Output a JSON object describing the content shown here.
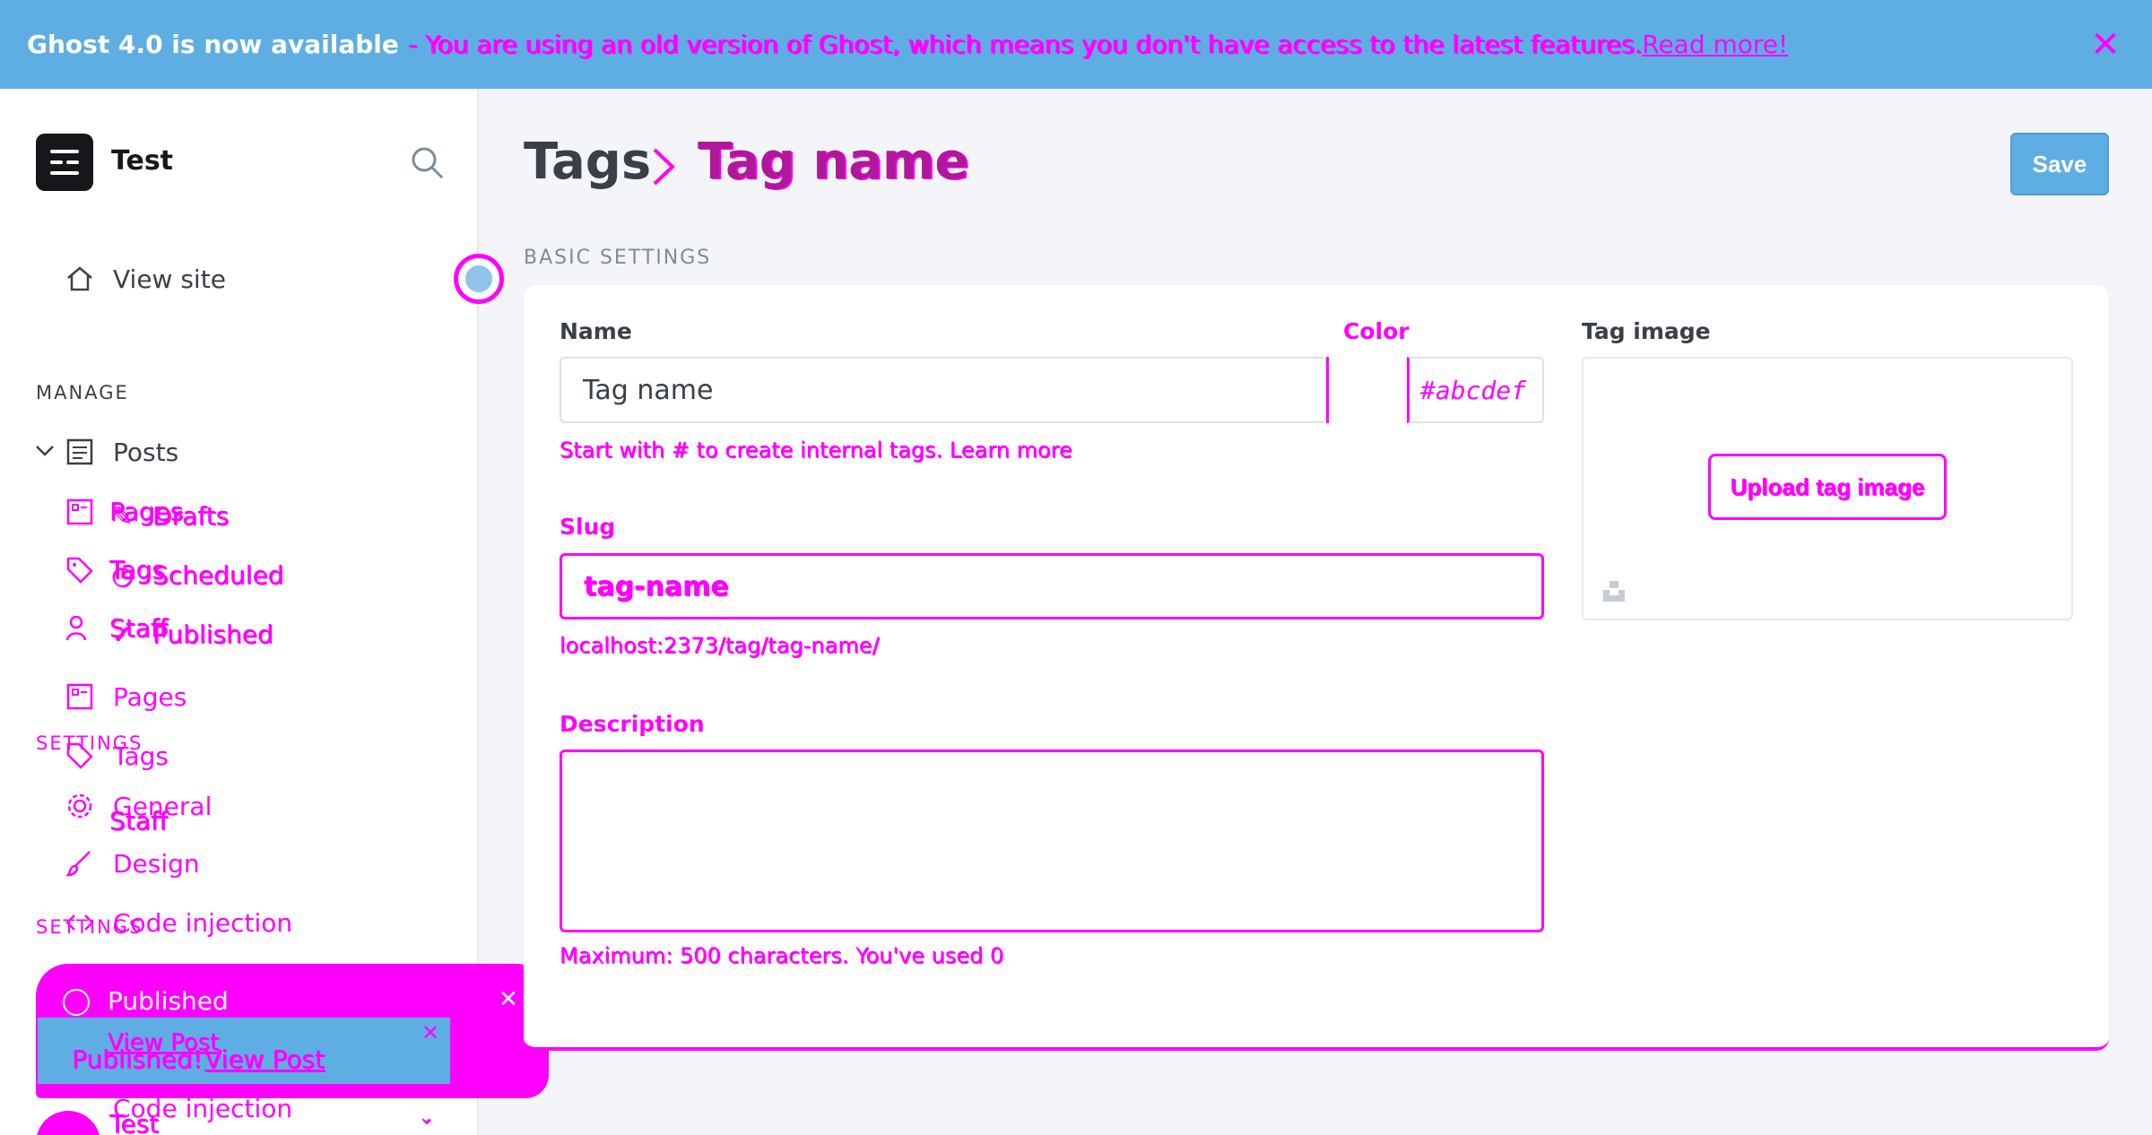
{
  "banner": {
    "title": "Ghost 4.0 is now available",
    "message": "- You are using an old version of Ghost, which means you don't have access to the latest features.",
    "link": "Read more!",
    "colors": {
      "background": "#5eaee3",
      "glitch": "#ff00ff"
    }
  },
  "sidebar": {
    "site_title": "Test",
    "view_site": "View site",
    "manage_label": "MANAGE",
    "settings_label": "SETTINGS",
    "settings_label_2": "SETTINGS",
    "items": [
      {
        "label": "Posts",
        "icon": "posts-icon"
      },
      {
        "label": "Pages",
        "icon": "pages-icon"
      },
      {
        "label": "Tags",
        "icon": "tag-icon"
      },
      {
        "label": "Staff",
        "icon": "staff-icon"
      },
      {
        "label": "Pages",
        "icon": "pages-icon"
      },
      {
        "label": "Tags",
        "icon": "tag-icon"
      },
      {
        "label": "Staff",
        "icon": "staff-icon"
      },
      {
        "label": "General",
        "icon": "gear-icon"
      },
      {
        "label": "Design",
        "icon": "brush-icon"
      },
      {
        "label": "Code injection",
        "icon": "code-icon"
      },
      {
        "label": "Code injection",
        "icon": "code-icon"
      },
      {
        "label": "Test",
        "icon": "avatar-icon"
      }
    ],
    "post_sub": [
      "Drafts",
      "Scheduled",
      "Published"
    ]
  },
  "toast": {
    "title": "Published",
    "inner_link": "View Post",
    "inner_text": "Published!",
    "inner_link_2": "View Post"
  },
  "header": {
    "breadcrumb_parent": "Tags",
    "breadcrumb_current": "Tag name",
    "save_label": "Save"
  },
  "form": {
    "section_label": "BASIC SETTINGS",
    "name_label": "Name",
    "name_value": "Tag name",
    "name_hint": "Start with # to create internal tags. Learn more",
    "color_label": "Color",
    "color_value": "#abcdef",
    "slug_label": "Slug",
    "slug_value": "tag-name",
    "slug_url": "localhost:2373/tag/tag-name/",
    "description_label": "Description",
    "description_hint": "Maximum: 500 characters. You've used 0",
    "tag_image_label": "Tag image",
    "upload_label": "Upload tag image"
  }
}
